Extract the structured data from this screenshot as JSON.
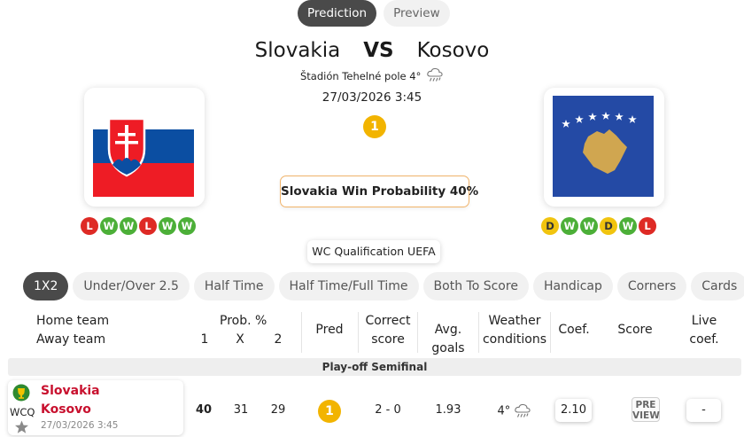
{
  "top_tabs": [
    {
      "label": "Prediction",
      "active": true
    },
    {
      "label": "Preview",
      "active": false
    }
  ],
  "match": {
    "home": "Slovakia",
    "vs": "VS",
    "away": "Kosovo",
    "venue": "Štadión Tehelné pole 4°",
    "weather_icon": "rain-cloud-icon",
    "datetime": "27/03/2026 3:45",
    "prediction": "1",
    "win_probability": "Slovakia Win Probability 40%",
    "competition": "WC Qualification UEFA"
  },
  "form": {
    "home": [
      "L",
      "W",
      "W",
      "L",
      "W",
      "W"
    ],
    "away": [
      "D",
      "W",
      "W",
      "D",
      "W",
      "L"
    ]
  },
  "market_tabs": [
    "1X2",
    "Under/Over 2.5",
    "Half Time",
    "Half Time/Full Time",
    "Both To Score",
    "Handicap",
    "Corners",
    "Cards"
  ],
  "table_header": {
    "home_team": "Home team",
    "away_team": "Away team",
    "prob": "Prob. %",
    "p1": "1",
    "px": "X",
    "p2": "2",
    "pred": "Pred",
    "correct_score_1": "Correct",
    "correct_score_2": "score",
    "avg_goals": "Avg. goals",
    "weather_1": "Weather",
    "weather_2": "conditions",
    "coef": "Coef.",
    "score": "Score",
    "live_1": "Live",
    "live_2": "coef."
  },
  "section_title": "Play-off Semifinal",
  "row": {
    "competition_code": "WCQ",
    "home": "Slovakia",
    "away": "Kosovo",
    "date": "27/03/2026 3:45",
    "prob_1": "40",
    "prob_x": "31",
    "prob_2": "29",
    "pred": "1",
    "correct_score": "2 - 0",
    "avg_goals": "1.93",
    "weather": "4°",
    "coef": "2.10",
    "score_preview_1": "PRE",
    "score_preview_2": "VIEW",
    "live_coef": "-"
  },
  "colors": {
    "win": "#4caf38",
    "loss": "#de2a25",
    "draw": "#f1c40f",
    "prediction": "#f2b400",
    "team_name": "#c8102e",
    "active_tab": "#4a4a4a"
  }
}
